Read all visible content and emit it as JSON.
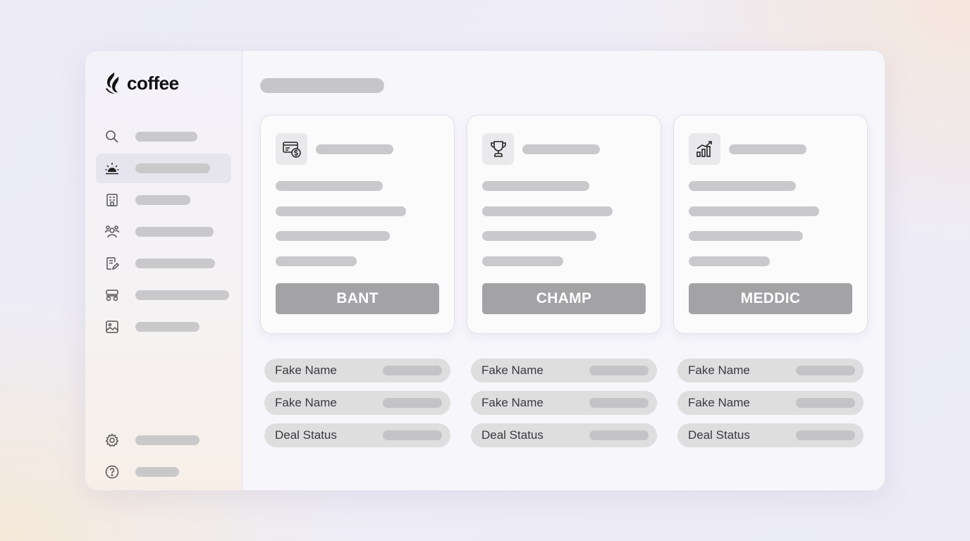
{
  "app": {
    "logo_text": "coffee"
  },
  "sidebar": {
    "items": [
      {
        "icon": "search-icon",
        "name": "sidebar-item-search"
      },
      {
        "icon": "sunrise-icon",
        "name": "sidebar-item-today",
        "active": true
      },
      {
        "icon": "building-icon",
        "name": "sidebar-item-companies"
      },
      {
        "icon": "people-icon",
        "name": "sidebar-item-contacts"
      },
      {
        "icon": "note-edit-icon",
        "name": "sidebar-item-notes"
      },
      {
        "icon": "seats-icon",
        "name": "sidebar-item-meetings"
      },
      {
        "icon": "image-icon",
        "name": "sidebar-item-media"
      }
    ],
    "bottom_items": [
      {
        "icon": "gear-icon",
        "name": "sidebar-item-settings"
      },
      {
        "icon": "help-icon",
        "name": "sidebar-item-help"
      }
    ]
  },
  "cards": [
    {
      "icon": "money-stack-icon",
      "button_label": "BANT"
    },
    {
      "icon": "trophy-icon",
      "button_label": "CHAMP"
    },
    {
      "icon": "growth-chart-icon",
      "button_label": "MEDDIC"
    }
  ],
  "fields": [
    [
      {
        "label": "Fake Name"
      },
      {
        "label": "Fake Name"
      },
      {
        "label": "Deal Status"
      }
    ],
    [
      {
        "label": "Fake Name"
      },
      {
        "label": "Fake Name"
      },
      {
        "label": "Deal Status"
      }
    ],
    [
      {
        "label": "Fake Name"
      },
      {
        "label": "Fake Name"
      },
      {
        "label": "Deal Status"
      }
    ]
  ],
  "colors": {
    "accent_button": "#a3a3a5",
    "placeholder": "#c9c9cb",
    "logo": "#111111"
  }
}
